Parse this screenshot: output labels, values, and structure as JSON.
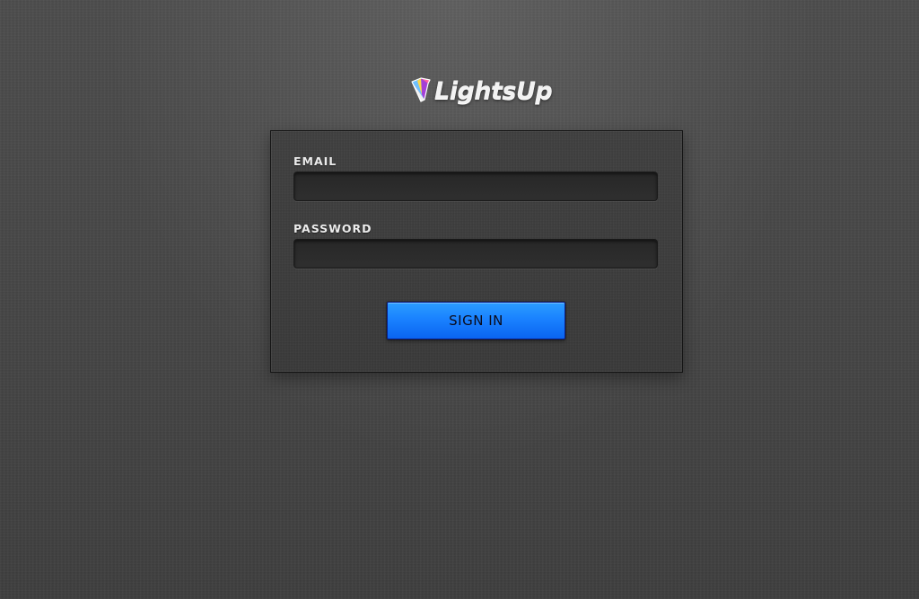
{
  "brand": {
    "name": "LightsUp",
    "logo_icon": "lightsup-logo-icon"
  },
  "login": {
    "email": {
      "label": "EMAIL",
      "value": "",
      "placeholder": ""
    },
    "password": {
      "label": "PASSWORD",
      "value": "",
      "placeholder": ""
    },
    "submit_label": "SIGN IN"
  },
  "colors": {
    "background": "#4a4a4a",
    "panel": "#3c3c3c",
    "button": "#1a82ff"
  }
}
